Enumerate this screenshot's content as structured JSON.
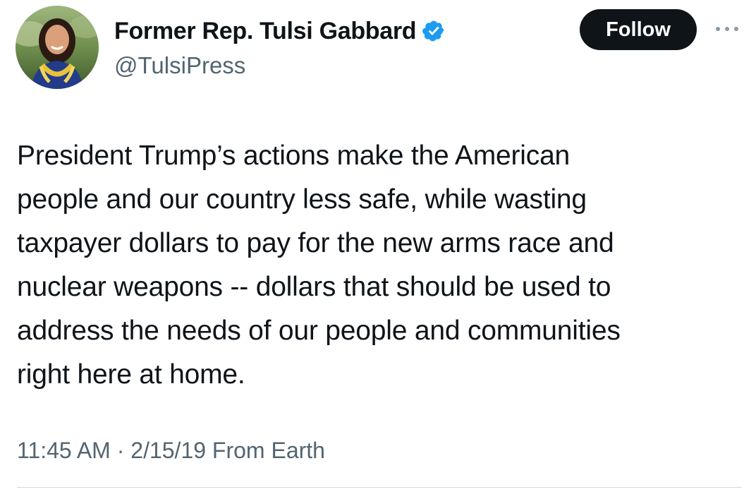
{
  "author": {
    "display_name": "Former Rep. Tulsi Gabbard",
    "handle": "@TulsiPress",
    "verified_icon": "verified-badge-icon",
    "avatar_icon": "profile-photo"
  },
  "actions": {
    "follow_label": "Follow",
    "more_icon": "more-options-icon"
  },
  "tweet": {
    "lines": [
      "President Trump’s actions make the American",
      "people and our country less safe, while wasting",
      "taxpayer dollars to pay for the new arms race and",
      "nuclear weapons -- dollars that should be used to",
      "address the needs of our people and communities",
      "right here at home."
    ],
    "meta": "11:45 AM · 2/15/19 From Earth"
  },
  "colors": {
    "text": "#0f1419",
    "secondary": "#536471",
    "verified": "#1d9bf0",
    "follow_bg": "#0f1419"
  }
}
